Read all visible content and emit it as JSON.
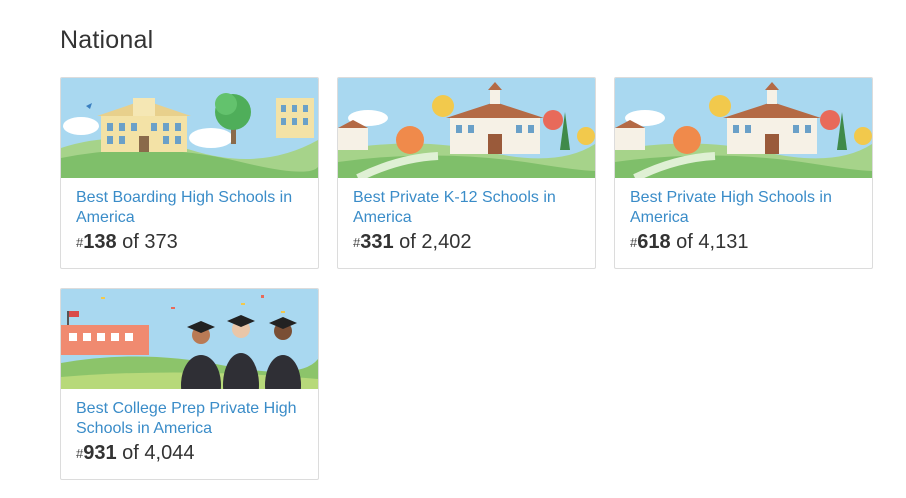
{
  "section": {
    "title": "National"
  },
  "cards": [
    {
      "title": "Best Boarding High Schools in America",
      "rank_symbol": "#",
      "rank": "138",
      "of_text": "of 373",
      "illustration": "boarding-school-illustration"
    },
    {
      "title": "Best Private K-12 Schools in America",
      "rank_symbol": "#",
      "rank": "331",
      "of_text": "of 2,402",
      "illustration": "campus-illustration"
    },
    {
      "title": "Best Private High Schools in America",
      "rank_symbol": "#",
      "rank": "618",
      "of_text": "of 4,131",
      "illustration": "campus-illustration"
    },
    {
      "title": "Best College Prep Private High Schools in America",
      "rank_symbol": "#",
      "rank": "931",
      "of_text": "of 4,044",
      "illustration": "graduation-illustration"
    }
  ],
  "colors": {
    "link": "#3a8cc8",
    "sky": "#a9d8f0",
    "grass": "#8cc46a"
  }
}
